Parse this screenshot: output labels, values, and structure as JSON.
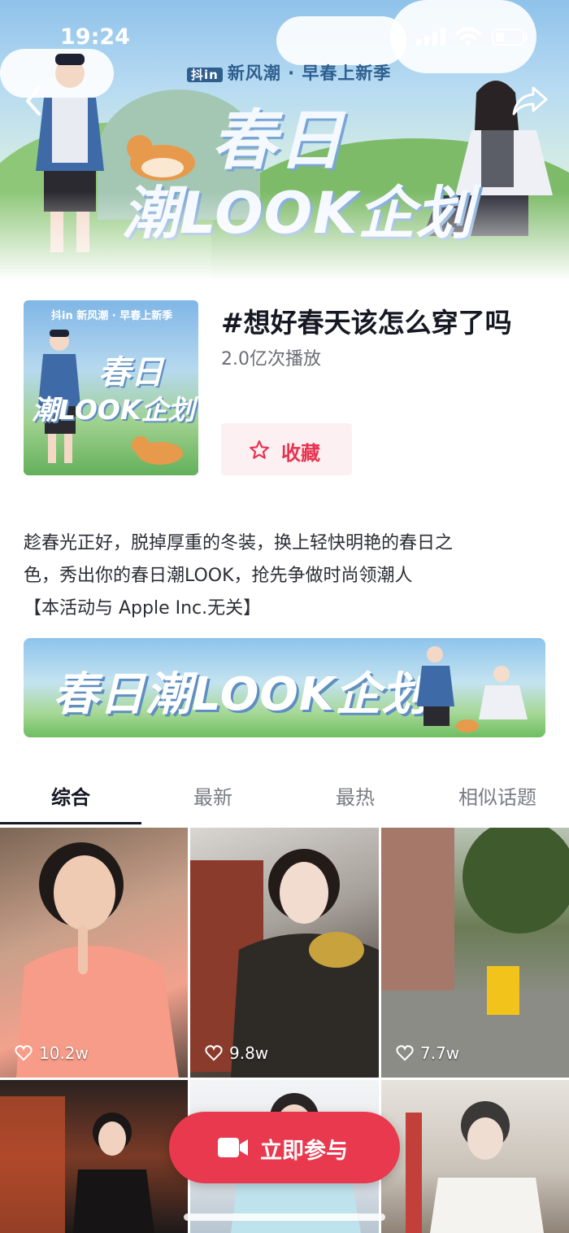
{
  "status_bar": {
    "time": "19:24"
  },
  "hero": {
    "brand_chip": "抖in",
    "brand_text": "新风潮 · 早春上新季",
    "title_line1": "春日",
    "title_line2": "潮LOOK企划"
  },
  "topic": {
    "title": "#想好春天该怎么穿了吗",
    "plays": "2.0亿次播放",
    "favorite_label": "收藏"
  },
  "cover": {
    "brand": "抖in 新风潮 · 早春上新季",
    "title_line1": "春日",
    "title_line2": "潮LOOK企划"
  },
  "description": {
    "line1": "趁春光正好，脱掉厚重的冬装，换上轻快明艳的春日之",
    "line2": "色，秀出你的春日潮LOOK，抢先争做时尚领潮人",
    "line3": "【本活动与 Apple Inc.无关】"
  },
  "banner": {
    "title": "春日潮LOOK企划"
  },
  "tabs": [
    {
      "label": "综合",
      "active": true
    },
    {
      "label": "最新",
      "active": false
    },
    {
      "label": "最热",
      "active": false
    },
    {
      "label": "相似话题",
      "active": false
    }
  ],
  "videos": [
    {
      "likes": "10.2w"
    },
    {
      "likes": "9.8w"
    },
    {
      "likes": "7.7w"
    },
    {
      "likes": ""
    },
    {
      "likes": ""
    },
    {
      "likes": ""
    }
  ],
  "cta": {
    "label": "立即参与"
  },
  "colors": {
    "accent": "#e8394f",
    "text": "#161823",
    "muted": "#6b6d76"
  },
  "icons": [
    "back-icon",
    "share-icon",
    "star-icon",
    "heart-icon",
    "video-camera-icon",
    "signal-icon",
    "wifi-icon",
    "battery-icon"
  ]
}
